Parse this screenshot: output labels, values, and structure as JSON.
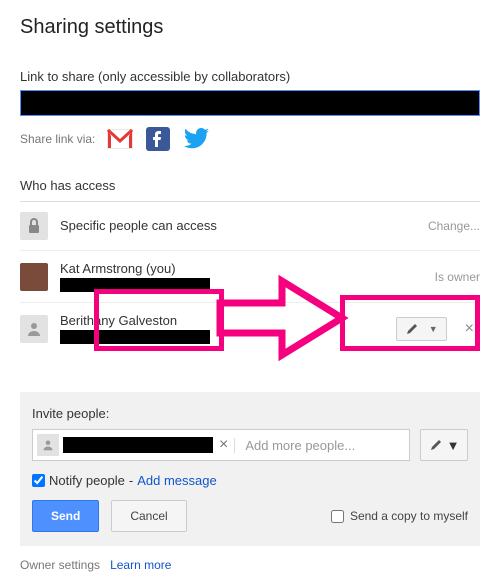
{
  "title": "Sharing settings",
  "link_section": {
    "label": "Link to share (only accessible by collaborators)",
    "value": "████████████████████████████████████████████████"
  },
  "share_via_label": "Share link via:",
  "who_has_access_title": "Who has access",
  "access_row": {
    "label": "Specific people can access",
    "change": "Change..."
  },
  "users": [
    {
      "name": "Kat Armstrong (you)",
      "role": "Is owner"
    },
    {
      "name": "Berithany Galveston",
      "role": "Can edit"
    }
  ],
  "invite": {
    "label": "Invite people:",
    "chip_name": "██████████",
    "add_more_placeholder": "Add more people...",
    "notify_label": "Notify people",
    "notify_checked": true,
    "add_message": "Add message",
    "send": "Send",
    "cancel": "Cancel",
    "send_copy_label": "Send a copy to myself",
    "send_copy_checked": false
  },
  "footer": {
    "owner_settings": "Owner settings",
    "learn_more": "Learn more"
  },
  "icons": {
    "gmail": "gmail-icon",
    "facebook": "facebook-icon",
    "twitter": "twitter-icon",
    "person": "person-icon",
    "pencil": "pencil-icon",
    "chevron": "chevron-down-icon",
    "close": "close-icon"
  },
  "colors": {
    "highlight": "#f5007e",
    "primary": "#4d90fe",
    "link": "#1155cc"
  }
}
